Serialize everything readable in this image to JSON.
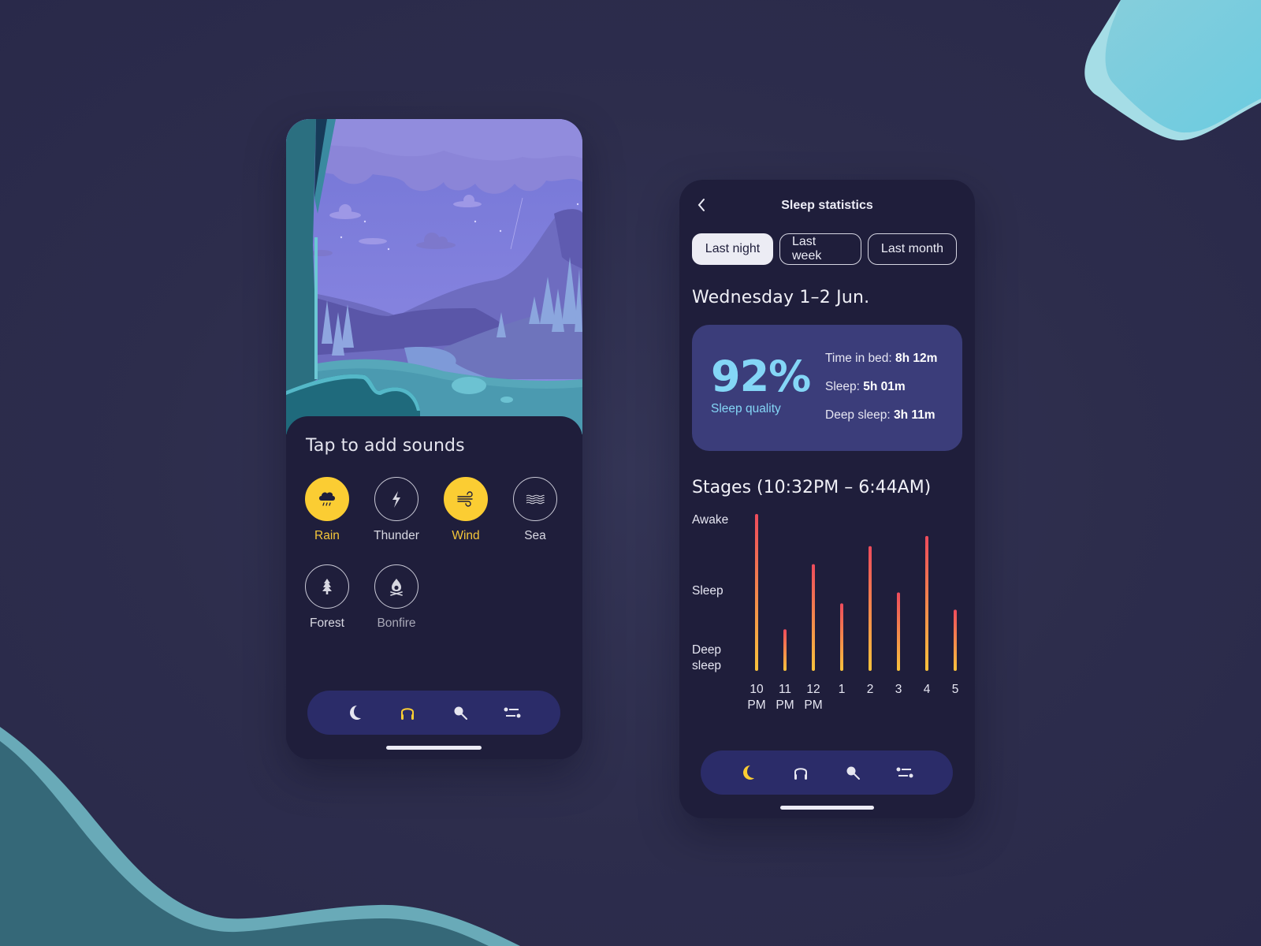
{
  "sounds_screen": {
    "title": "Tap to add sounds",
    "sounds": [
      {
        "label": "Rain",
        "icon": "rain-cloud-icon",
        "active": true
      },
      {
        "label": "Thunder",
        "icon": "lightning-icon",
        "active": false
      },
      {
        "label": "Wind",
        "icon": "wind-icon",
        "active": true
      },
      {
        "label": "Sea",
        "icon": "waves-icon",
        "active": false
      },
      {
        "label": "Forest",
        "icon": "tree-icon",
        "active": false
      },
      {
        "label": "Bonfire",
        "icon": "bonfire-icon",
        "active": false
      }
    ],
    "nav": [
      {
        "icon": "moon-icon",
        "active": false
      },
      {
        "icon": "headphones-icon",
        "active": true
      },
      {
        "icon": "search-icon",
        "active": false
      },
      {
        "icon": "sliders-icon",
        "active": false
      }
    ]
  },
  "stats_screen": {
    "title": "Sleep statistics",
    "back_icon": "chevron-left-icon",
    "tabs": [
      {
        "label": "Last night",
        "selected": true
      },
      {
        "label": "Last week",
        "selected": false
      },
      {
        "label": "Last month",
        "selected": false
      }
    ],
    "date": "Wednesday 1–2 Jun.",
    "summary": {
      "quality_value": "92%",
      "quality_label": "Sleep quality",
      "stats": [
        {
          "label": "Time in bed: ",
          "value": "8h 12m"
        },
        {
          "label": "Sleep: ",
          "value": "5h 01m"
        },
        {
          "label": "Deep sleep: ",
          "value": "3h 11m"
        }
      ]
    },
    "stages_title": "Stages (10:32PM – 6:44AM)",
    "nav": [
      {
        "icon": "moon-icon",
        "active": true
      },
      {
        "icon": "headphones-icon",
        "active": false
      },
      {
        "icon": "search-icon",
        "active": false
      },
      {
        "icon": "sliders-icon",
        "active": false
      }
    ]
  },
  "colors": {
    "accent_yellow": "#fbcd33",
    "accent_blue": "#84d6f6",
    "bar_top": "#ee4b5c",
    "bar_bottom": "#f9c33c",
    "card": "#3b3d7a",
    "navbar": "#2b2c69",
    "phone_bg": "#1f1e3b"
  },
  "chart_data": {
    "type": "bar",
    "title": "Stages (10:32PM – 6:44AM)",
    "categories": [
      "10 PM",
      "11 PM",
      "12 PM",
      "1",
      "2",
      "3",
      "4",
      "5"
    ],
    "x_tick_labels": [
      [
        "10",
        "PM"
      ],
      [
        "11",
        "PM"
      ],
      [
        "12",
        "PM"
      ],
      [
        "1"
      ],
      [
        "2"
      ],
      [
        "3"
      ],
      [
        "4"
      ],
      [
        "5"
      ]
    ],
    "y_levels": [
      {
        "label": "Awake",
        "value": 2
      },
      {
        "label": "Sleep",
        "value": 1
      },
      {
        "label": "Deep sleep",
        "value": 0
      }
    ],
    "values": [
      2.0,
      0.53,
      1.36,
      0.86,
      1.59,
      1.0,
      1.72,
      0.78
    ],
    "ylim": [
      0,
      2
    ],
    "xlabel": "",
    "ylabel": "",
    "grid": false,
    "legend": "none"
  }
}
